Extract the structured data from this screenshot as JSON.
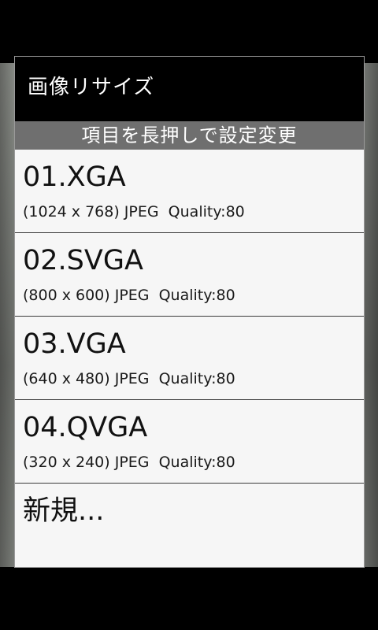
{
  "dialog": {
    "title": "画像リサイズ",
    "section_header": "項目を長押しで設定変更"
  },
  "presets": [
    {
      "title": "01.XGA",
      "detail": "(1024 x 768) JPEG  Quality:80"
    },
    {
      "title": "02.SVGA",
      "detail": "(800 x 600) JPEG  Quality:80"
    },
    {
      "title": "03.VGA",
      "detail": "(640 x 480) JPEG  Quality:80"
    },
    {
      "title": "04.QVGA",
      "detail": "(320 x 240) JPEG  Quality:80"
    }
  ],
  "new_item": {
    "label": "新規..."
  },
  "colors": {
    "title_bar": "#000000",
    "section_header": "#6f6f6f",
    "list_bg": "#f6f6f6"
  }
}
